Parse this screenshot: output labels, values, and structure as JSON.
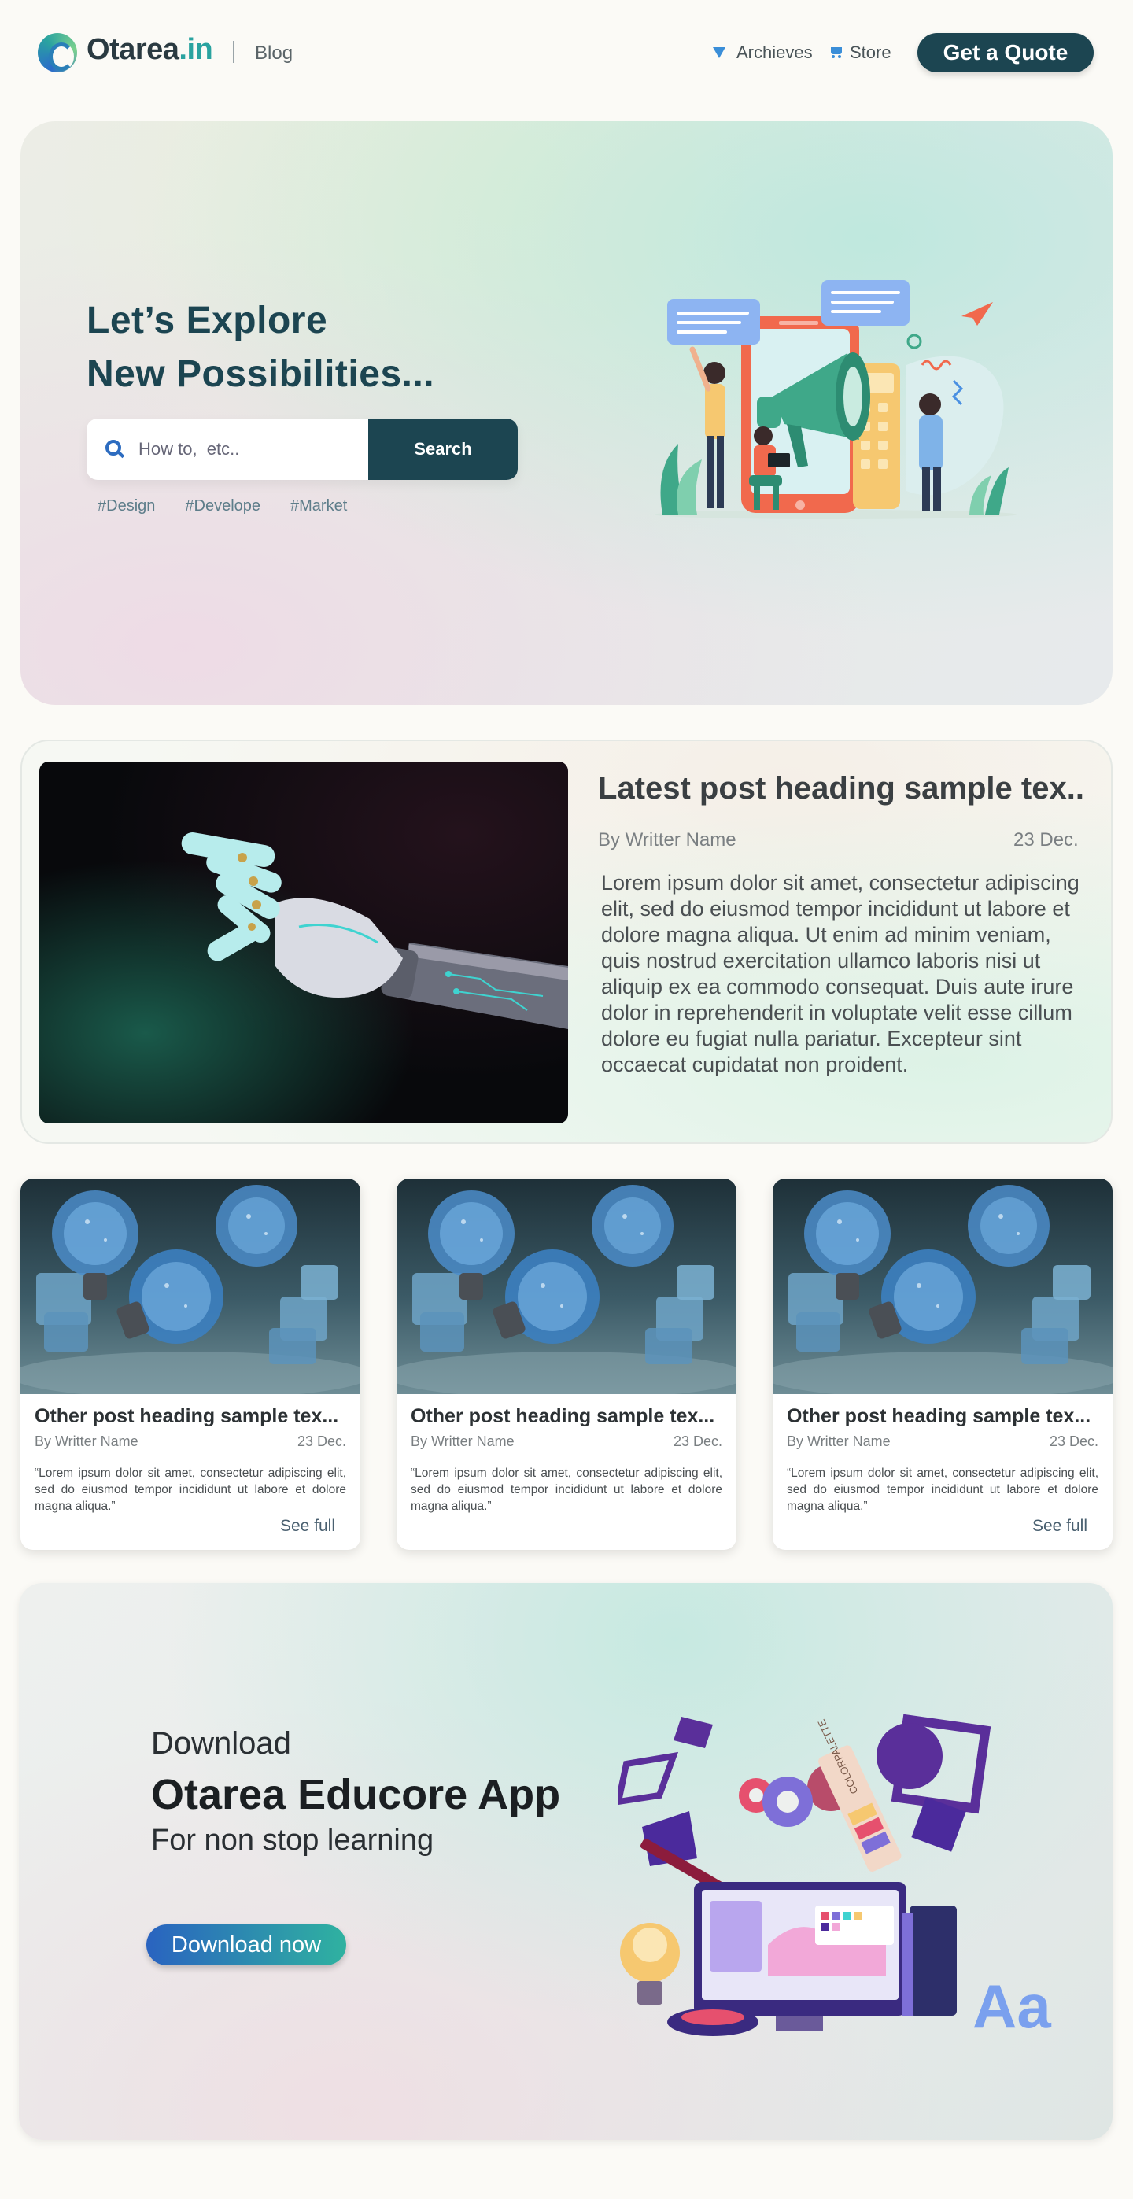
{
  "header": {
    "brand_main": "Otarea",
    "brand_suffix": ".in",
    "section": "Blog",
    "nav": [
      {
        "label": "Archieves",
        "icon": "triangle-down-icon"
      },
      {
        "label": "Store",
        "icon": "cart-icon"
      }
    ],
    "cta_label": "Get a Quote",
    "colors": {
      "brand": "#1c4551",
      "accent": "#2aa3a0",
      "icon": "#3a8ed8"
    }
  },
  "hero": {
    "title_line1": "Let’s Explore",
    "title_line2": "New Possibilities...",
    "search_placeholder": "How to,  etc..",
    "search_button": "Search",
    "tags": [
      "#Design",
      "#Develope",
      "#Market"
    ]
  },
  "latest_post": {
    "title": "Latest post heading sample tex..",
    "author": "By Writter Name",
    "date": "23 Dec.",
    "body": "Lorem ipsum dolor sit amet, consectetur adipiscing elit, sed do eiusmod tempor incididunt ut labore et dolore magna aliqua. Ut enim ad minim veniam, quis nostrud exercitation ullamco laboris nisi ut aliquip ex ea commodo consequat. Duis aute irure dolor in reprehenderit in voluptate velit esse cillum dolore eu fugiat nulla pariatur. Excepteur sint occaecat cupidatat non proident."
  },
  "posts": [
    {
      "title": "Other post heading sample tex...",
      "author": "By Writter Name",
      "date": "23 Dec.",
      "excerpt": "“Lorem ipsum dolor sit amet, consectetur adipiscing elit, sed do eiusmod tempor incididunt ut labore et dolore magna aliqua.”",
      "link": "See full"
    },
    {
      "title": "Other post heading sample tex...",
      "author": "By Writter Name",
      "date": "23 Dec.",
      "excerpt": "“Lorem ipsum dolor sit amet, consectetur adipiscing elit, sed do eiusmod tempor incididunt ut labore et dolore magna aliqua.”",
      "link": ""
    },
    {
      "title": "Other post heading sample tex...",
      "author": "By Writter Name",
      "date": "23 Dec.",
      "excerpt": "“Lorem ipsum dolor sit amet, consectetur adipiscing elit, sed do eiusmod tempor incididunt ut labore et dolore magna aliqua.”",
      "link": "See full"
    }
  ],
  "download": {
    "pre": "Download",
    "title": "Otarea Educore App",
    "subtitle": "For non stop learning",
    "button": "Download now",
    "palette_label": "COLORPALETTE",
    "font_sample": "Aa"
  }
}
